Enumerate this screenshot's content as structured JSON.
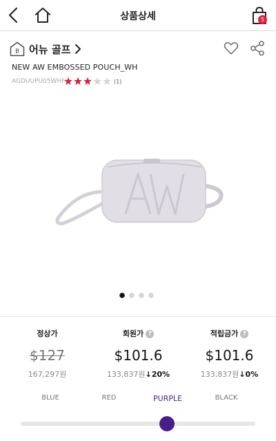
{
  "header": {
    "title": "상품상세",
    "cart_count": "5"
  },
  "brand": {
    "badge": "B",
    "name": "어뉴 골프"
  },
  "product": {
    "name": "NEW AW EMBOSSED POUCH_WH",
    "code": "AGDUUPU05WHF",
    "rating": 3,
    "rating_max": 5,
    "review_count": "(1)",
    "image_label": "AW",
    "carousel": {
      "total": 4,
      "active": 1
    }
  },
  "prices": {
    "regular": {
      "label": "정상가",
      "amount": "$127",
      "sub": "167,297원"
    },
    "member": {
      "label": "회원가",
      "help": "?",
      "amount": "$101.6",
      "sub": "133,837원",
      "discount": "↓20%"
    },
    "points": {
      "label": "적립금가",
      "help": "?",
      "amount": "$101.6",
      "sub": "133,837원",
      "discount": "↓0%"
    }
  },
  "currency_options": {
    "items": [
      "BLUE",
      "RED",
      "PURPLE",
      "BLACK"
    ],
    "selected": "PURPLE",
    "selected_color": "#4a1e8a"
  },
  "colors": {
    "accent": "#4a1e8a",
    "star": "#d9213a",
    "badge": "#e0213a"
  }
}
